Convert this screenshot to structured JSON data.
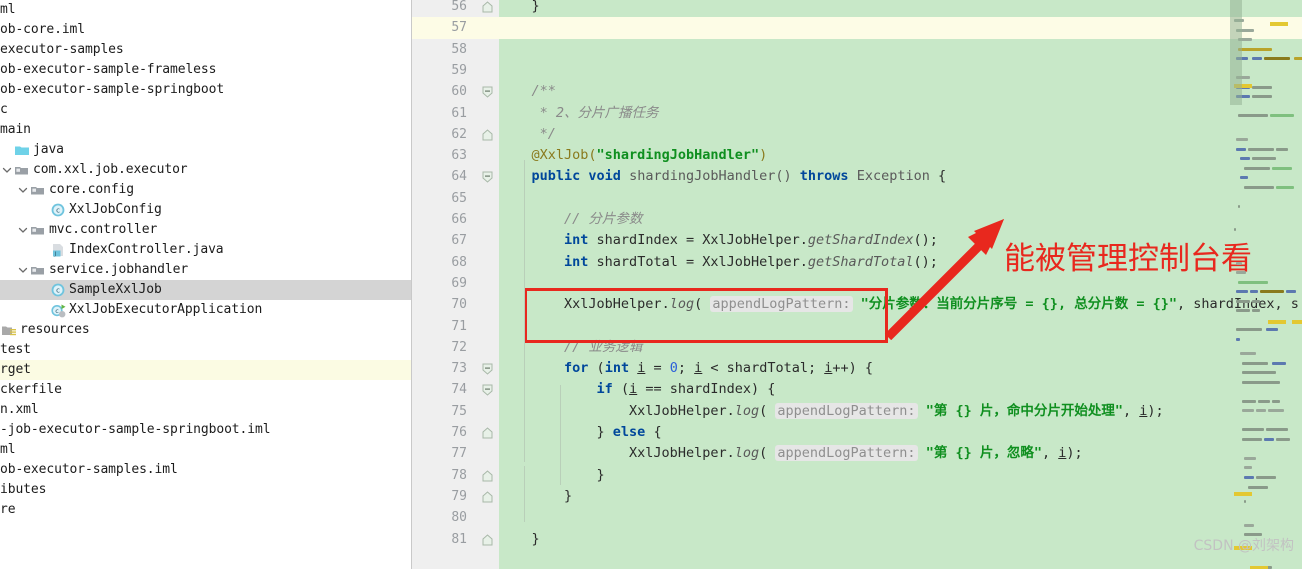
{
  "project_tree": {
    "rows": [
      {
        "label": "ml",
        "indent": 0,
        "icon": "none",
        "arrow": "none",
        "state": "normal",
        "clip": true
      },
      {
        "label": "ob-core.iml",
        "indent": 0,
        "icon": "none",
        "arrow": "none",
        "state": "normal",
        "clip": true
      },
      {
        "label": "executor-samples",
        "indent": 0,
        "icon": "none",
        "arrow": "none",
        "state": "normal",
        "clip": true
      },
      {
        "label": "ob-executor-sample-frameless",
        "indent": 0,
        "icon": "none",
        "arrow": "none",
        "state": "normal",
        "clip": true
      },
      {
        "label": "ob-executor-sample-springboot",
        "indent": 0,
        "icon": "none",
        "arrow": "none",
        "state": "normal",
        "clip": true
      },
      {
        "label": "c",
        "indent": 0,
        "icon": "none",
        "arrow": "none",
        "state": "normal",
        "clip": true
      },
      {
        "label": "main",
        "indent": 0,
        "icon": "none",
        "arrow": "none",
        "state": "normal",
        "clip": true
      },
      {
        "label": "java",
        "indent": 1,
        "icon": "folder-source",
        "arrow": "none",
        "state": "normal",
        "clip": false
      },
      {
        "label": "com.xxl.job.executor",
        "indent": 1,
        "icon": "package",
        "arrow": "expanded",
        "state": "normal",
        "clip": false
      },
      {
        "label": "core.config",
        "indent": 2,
        "icon": "package",
        "arrow": "expanded",
        "state": "normal",
        "clip": false
      },
      {
        "label": "XxlJobConfig",
        "indent": 3,
        "icon": "class",
        "arrow": "none",
        "state": "normal",
        "clip": false
      },
      {
        "label": "mvc.controller",
        "indent": 2,
        "icon": "package",
        "arrow": "expanded",
        "state": "normal",
        "clip": false
      },
      {
        "label": "IndexController.java",
        "indent": 3,
        "icon": "java-file",
        "arrow": "none",
        "state": "normal",
        "clip": false
      },
      {
        "label": "service.jobhandler",
        "indent": 2,
        "icon": "package",
        "arrow": "expanded",
        "state": "normal",
        "clip": false
      },
      {
        "label": "SampleXxlJob",
        "indent": 3,
        "icon": "class",
        "arrow": "none",
        "state": "selected",
        "clip": false
      },
      {
        "label": "XxlJobExecutorApplication",
        "indent": 3,
        "icon": "spring-class",
        "arrow": "none",
        "state": "normal",
        "clip": false
      },
      {
        "label": "resources",
        "indent": 1,
        "icon": "folder-resource",
        "arrow": "none",
        "state": "normal",
        "clip": true
      },
      {
        "label": "test",
        "indent": 0,
        "icon": "none",
        "arrow": "none",
        "state": "normal",
        "clip": true
      },
      {
        "label": "rget",
        "indent": 0,
        "icon": "none",
        "arrow": "none",
        "state": "highlight",
        "clip": true
      },
      {
        "label": "ckerfile",
        "indent": 0,
        "icon": "none",
        "arrow": "none",
        "state": "normal",
        "clip": true
      },
      {
        "label": "n.xml",
        "indent": 0,
        "icon": "none",
        "arrow": "none",
        "state": "normal",
        "clip": true
      },
      {
        "label": "-job-executor-sample-springboot.iml",
        "indent": 0,
        "icon": "none",
        "arrow": "none",
        "state": "normal",
        "clip": true
      },
      {
        "label": "ml",
        "indent": 0,
        "icon": "none",
        "arrow": "none",
        "state": "normal",
        "clip": true
      },
      {
        "label": "ob-executor-samples.iml",
        "indent": 0,
        "icon": "none",
        "arrow": "none",
        "state": "normal",
        "clip": true
      },
      {
        "label": "ibutes",
        "indent": 0,
        "icon": "none",
        "arrow": "none",
        "state": "normal",
        "clip": true
      },
      {
        "label": "re",
        "indent": 0,
        "icon": "none",
        "arrow": "none",
        "state": "normal",
        "clip": true
      }
    ]
  },
  "editor": {
    "first_line_number": 56,
    "current_line": 57,
    "lines": [
      {
        "n": 56,
        "fold": "end",
        "tokens": [
          {
            "t": "    }",
            "c": "plain"
          }
        ]
      },
      {
        "n": 57,
        "fold": "none",
        "tokens": []
      },
      {
        "n": 58,
        "fold": "none",
        "tokens": []
      },
      {
        "n": 59,
        "fold": "none",
        "tokens": []
      },
      {
        "n": 60,
        "fold": "start",
        "tokens": [
          {
            "t": "    ",
            "c": "plain"
          },
          {
            "t": "/**",
            "c": "cmt"
          }
        ]
      },
      {
        "n": 61,
        "fold": "none",
        "tokens": [
          {
            "t": "     * 2、分片广播任务",
            "c": "cmt"
          }
        ]
      },
      {
        "n": 62,
        "fold": "end",
        "tokens": [
          {
            "t": "     */",
            "c": "cmt"
          }
        ]
      },
      {
        "n": 63,
        "fold": "none",
        "tokens": [
          {
            "t": "    ",
            "c": "plain"
          },
          {
            "t": "@XxlJob(",
            "c": "ann"
          },
          {
            "t": "\"shardingJobHandler\"",
            "c": "str"
          },
          {
            "t": ")",
            "c": "ann"
          }
        ]
      },
      {
        "n": 64,
        "fold": "start",
        "tokens": [
          {
            "t": "    ",
            "c": "plain"
          },
          {
            "t": "public void ",
            "c": "kw"
          },
          {
            "t": "shardingJobHandler()",
            "c": "mthb"
          },
          {
            "t": " ",
            "c": "plain"
          },
          {
            "t": "throws",
            "c": "kw"
          },
          {
            "t": " ",
            "c": "plain"
          },
          {
            "t": "Exception",
            "c": "mthb"
          },
          {
            "t": " {",
            "c": "plain"
          }
        ]
      },
      {
        "n": 65,
        "fold": "none",
        "tokens": []
      },
      {
        "n": 66,
        "fold": "none",
        "tokens": [
          {
            "t": "        ",
            "c": "plain"
          },
          {
            "t": "// 分片参数",
            "c": "cmt"
          }
        ]
      },
      {
        "n": 67,
        "fold": "none",
        "tokens": [
          {
            "t": "        ",
            "c": "plain"
          },
          {
            "t": "int",
            "c": "kw"
          },
          {
            "t": " shardIndex = XxlJobHelper.",
            "c": "plain"
          },
          {
            "t": "getShardIndex",
            "c": "mth"
          },
          {
            "t": "();",
            "c": "plain"
          }
        ]
      },
      {
        "n": 68,
        "fold": "none",
        "tokens": [
          {
            "t": "        ",
            "c": "plain"
          },
          {
            "t": "int",
            "c": "kw"
          },
          {
            "t": " shardTotal = XxlJobHelper.",
            "c": "plain"
          },
          {
            "t": "getShardTotal",
            "c": "mth"
          },
          {
            "t": "();",
            "c": "plain"
          }
        ]
      },
      {
        "n": 69,
        "fold": "none",
        "tokens": []
      },
      {
        "n": 70,
        "fold": "none",
        "tokens": [
          {
            "t": "        ",
            "c": "plain"
          },
          {
            "t": "XxlJobHelper.",
            "c": "plain"
          },
          {
            "t": "log",
            "c": "mth"
          },
          {
            "t": "( ",
            "c": "plain"
          },
          {
            "t": "appendLogPattern:",
            "c": "hint"
          },
          {
            "t": " ",
            "c": "plain"
          },
          {
            "t": "\"分片参数：当前分片序号 = {}, 总分片数 = {}\"",
            "c": "str"
          },
          {
            "t": ", shardIndex, s",
            "c": "plain"
          }
        ]
      },
      {
        "n": 71,
        "fold": "none",
        "tokens": []
      },
      {
        "n": 72,
        "fold": "none",
        "tokens": [
          {
            "t": "        ",
            "c": "plain"
          },
          {
            "t": "// 业务逻辑",
            "c": "cmt"
          }
        ]
      },
      {
        "n": 73,
        "fold": "start",
        "tokens": [
          {
            "t": "        ",
            "c": "plain"
          },
          {
            "t": "for",
            "c": "kw"
          },
          {
            "t": " (",
            "c": "plain"
          },
          {
            "t": "int",
            "c": "kw"
          },
          {
            "t": " ",
            "c": "plain"
          },
          {
            "t": "i",
            "c": "uline"
          },
          {
            "t": " = ",
            "c": "plain"
          },
          {
            "t": "0",
            "c": "num"
          },
          {
            "t": "; ",
            "c": "plain"
          },
          {
            "t": "i",
            "c": "uline"
          },
          {
            "t": " < shardTotal; ",
            "c": "plain"
          },
          {
            "t": "i",
            "c": "uline"
          },
          {
            "t": "++) {",
            "c": "plain"
          }
        ]
      },
      {
        "n": 74,
        "fold": "start",
        "tokens": [
          {
            "t": "            ",
            "c": "plain"
          },
          {
            "t": "if",
            "c": "kw"
          },
          {
            "t": " (",
            "c": "plain"
          },
          {
            "t": "i",
            "c": "uline"
          },
          {
            "t": " == shardIndex) {",
            "c": "plain"
          }
        ]
      },
      {
        "n": 75,
        "fold": "none",
        "tokens": [
          {
            "t": "                ",
            "c": "plain"
          },
          {
            "t": "XxlJobHelper.",
            "c": "plain"
          },
          {
            "t": "log",
            "c": "mth"
          },
          {
            "t": "( ",
            "c": "plain"
          },
          {
            "t": "appendLogPattern:",
            "c": "hint"
          },
          {
            "t": " ",
            "c": "plain"
          },
          {
            "t": "\"第 {} 片，命中分片开始处理\"",
            "c": "str"
          },
          {
            "t": ", ",
            "c": "plain"
          },
          {
            "t": "i",
            "c": "uline"
          },
          {
            "t": ");",
            "c": "plain"
          }
        ]
      },
      {
        "n": 76,
        "fold": "end",
        "tokens": [
          {
            "t": "            } ",
            "c": "plain"
          },
          {
            "t": "else",
            "c": "kw"
          },
          {
            "t": " {",
            "c": "plain"
          }
        ]
      },
      {
        "n": 77,
        "fold": "none",
        "tokens": [
          {
            "t": "                ",
            "c": "plain"
          },
          {
            "t": "XxlJobHelper.",
            "c": "plain"
          },
          {
            "t": "log",
            "c": "mth"
          },
          {
            "t": "( ",
            "c": "plain"
          },
          {
            "t": "appendLogPattern:",
            "c": "hint"
          },
          {
            "t": " ",
            "c": "plain"
          },
          {
            "t": "\"第 {} 片，忽略\"",
            "c": "str"
          },
          {
            "t": ", ",
            "c": "plain"
          },
          {
            "t": "i",
            "c": "uline"
          },
          {
            "t": ");",
            "c": "plain"
          }
        ]
      },
      {
        "n": 78,
        "fold": "end",
        "tokens": [
          {
            "t": "            }",
            "c": "plain"
          }
        ]
      },
      {
        "n": 79,
        "fold": "end",
        "tokens": [
          {
            "t": "        }",
            "c": "plain"
          }
        ]
      },
      {
        "n": 80,
        "fold": "none",
        "tokens": []
      },
      {
        "n": 81,
        "fold": "end",
        "tokens": [
          {
            "t": "    }",
            "c": "plain"
          }
        ]
      }
    ]
  },
  "annotations": {
    "red_text": "能被管理控制台看",
    "red_color": "#e8281e",
    "highlight_box_line": 70,
    "arrow_label": "arrow-pointing-to-annotation"
  },
  "watermark": {
    "text": "CSDN @刘架构"
  },
  "colors": {
    "editor_background": "#c8e8c8",
    "gutter_background": "#efefef",
    "current_line": "#fdfce6",
    "selection": "#d4d4d4",
    "accent_red": "#e8281e",
    "string_green": "#0f8f1f",
    "keyword_blue": "#00479b"
  }
}
